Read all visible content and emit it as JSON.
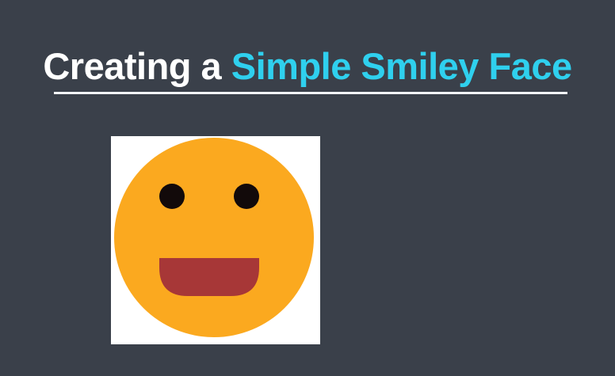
{
  "slide": {
    "title_plain": "Creating a",
    "title_accent": "Simple Smiley Face"
  },
  "colors": {
    "background": "#3a404a",
    "title_plain": "#ffffff",
    "title_accent": "#2fd0ee",
    "face": "#fba91f",
    "eyes": "#120a0a",
    "mouth": "#a73737",
    "frame": "#ffffff"
  }
}
